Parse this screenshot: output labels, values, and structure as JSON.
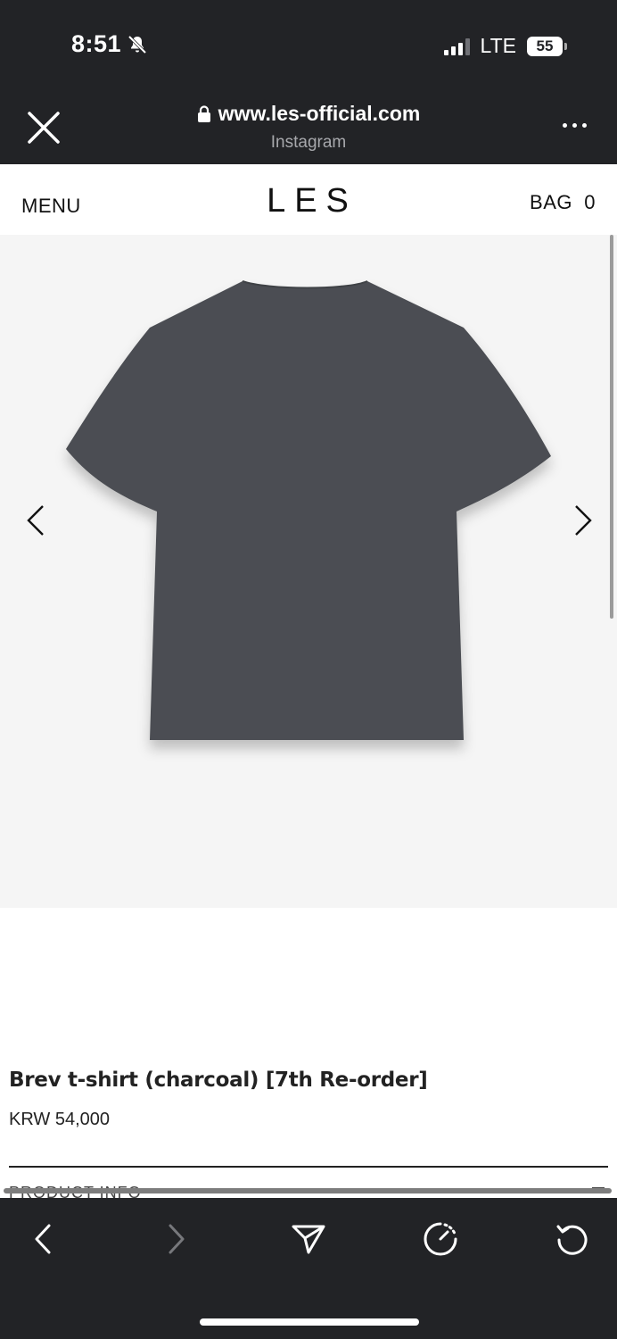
{
  "status_bar": {
    "time": "8:51",
    "network": "LTE",
    "battery": "55"
  },
  "browser": {
    "url": "www.les-official.com",
    "source": "Instagram"
  },
  "site_header": {
    "menu_label": "MENU",
    "brand": "LES",
    "bag_label": "BAG",
    "bag_count": "0"
  },
  "product": {
    "image_icon": "tshirt-image",
    "title": "Brev t-shirt (charcoal) [7th Re-order]",
    "price": "KRW 54,000",
    "section_label": "PRODUCT INFO"
  },
  "colors": {
    "chrome": "#222326",
    "image_bg": "#f5f5f5",
    "shirt": "#4a4d51"
  }
}
